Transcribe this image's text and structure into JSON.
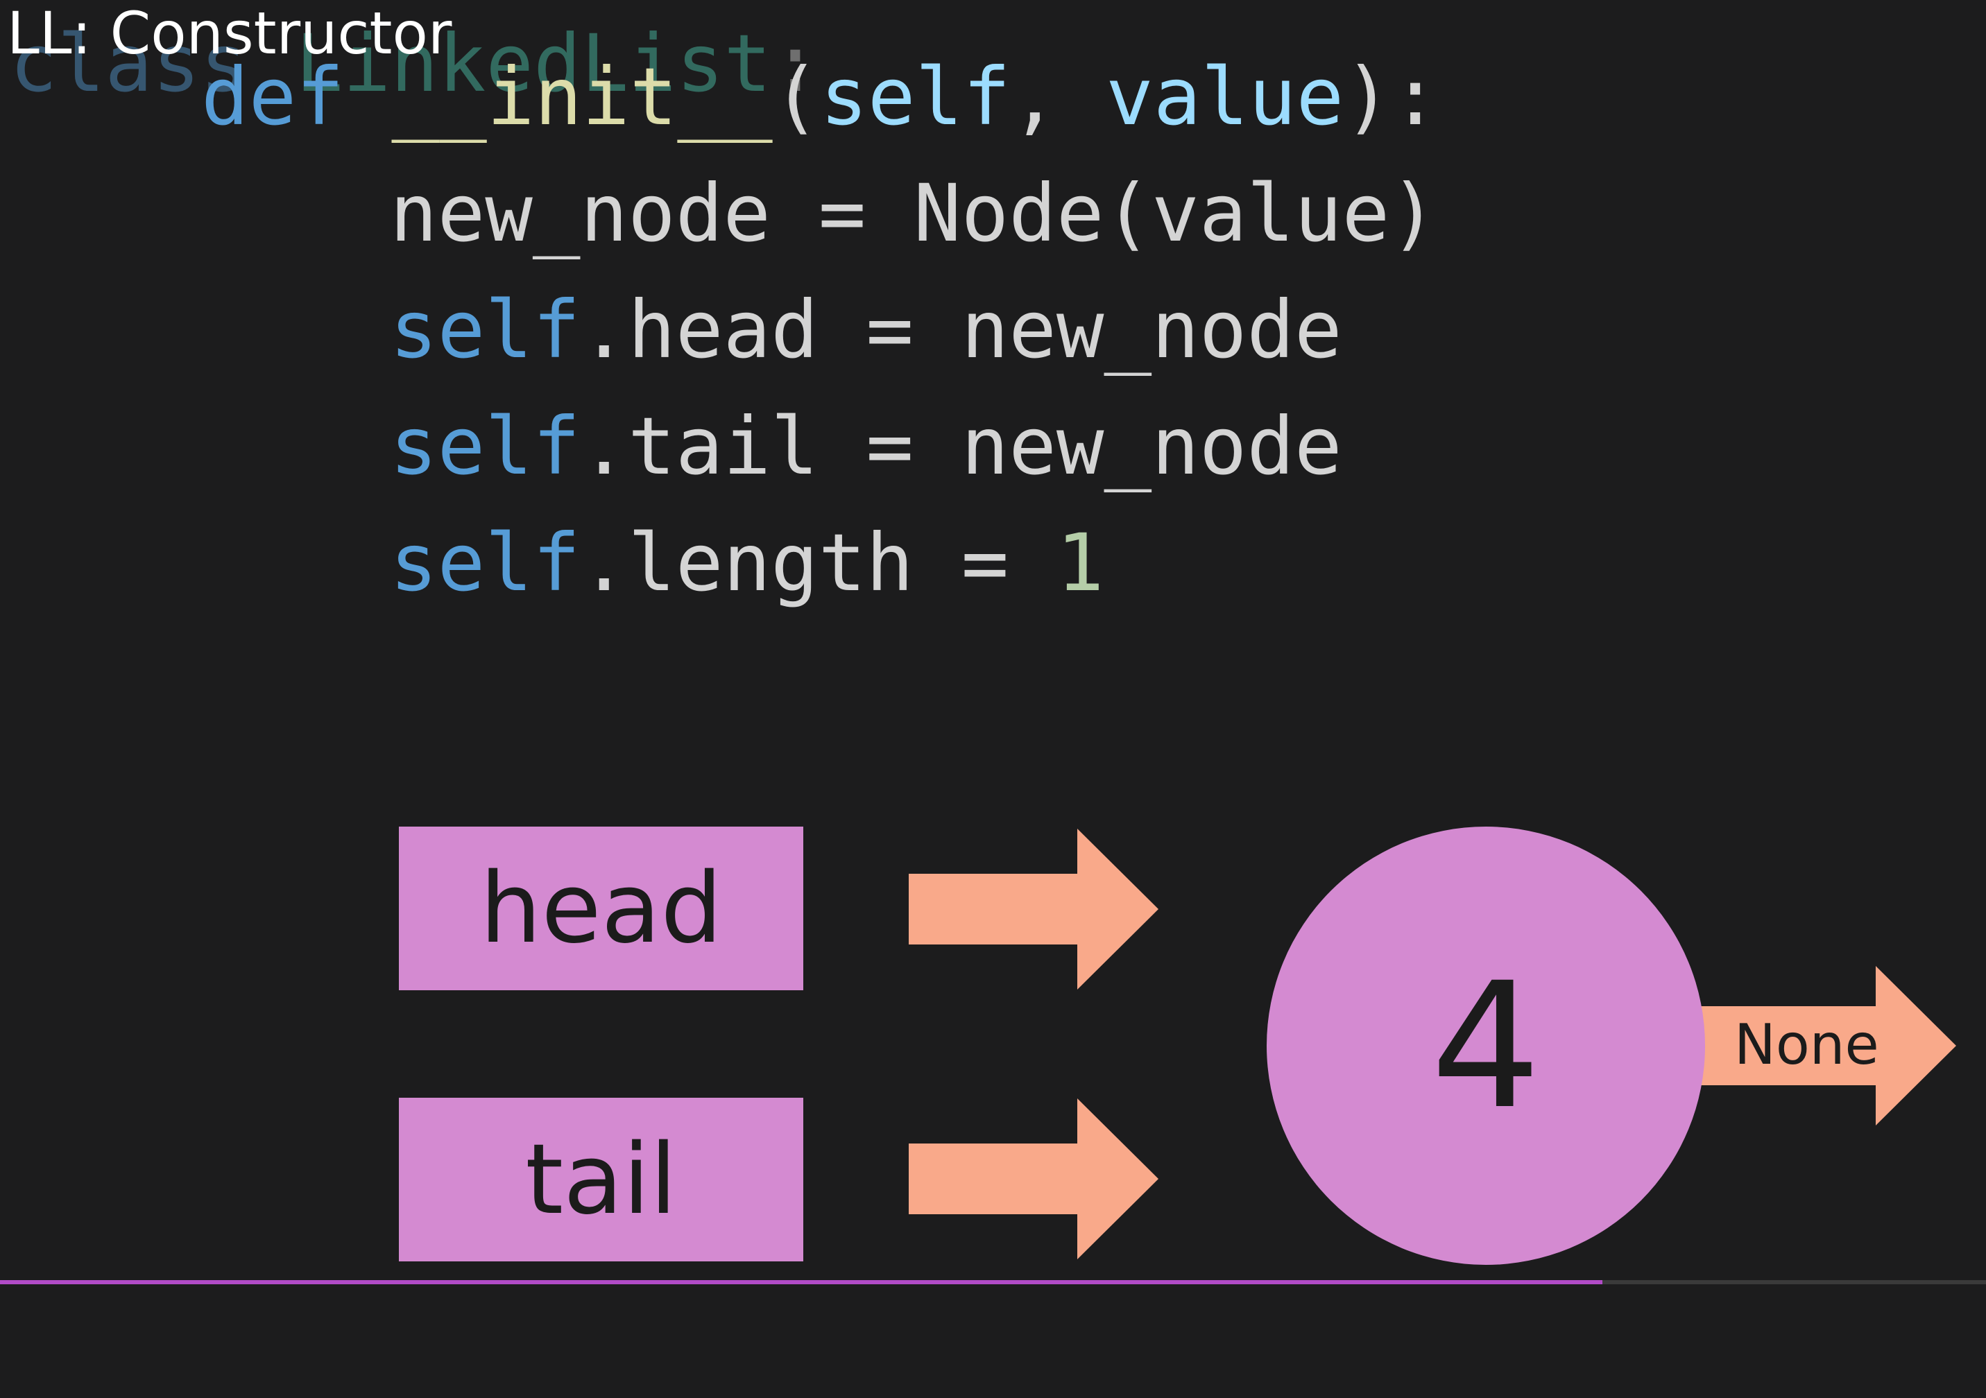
{
  "title": "LL: Constructor",
  "code": {
    "line0": {
      "kw": "class",
      "name": "LinkedList",
      "colon": ":"
    },
    "line1": {
      "kw": "def",
      "fn": "__init__",
      "open": "(",
      "p1": "self",
      "comma": ", ",
      "p2": "value",
      "close": "):"
    },
    "line2": {
      "text": "new_node = Node(value)"
    },
    "line3": {
      "self": "self",
      "rest": ".head = new_node"
    },
    "line4": {
      "self": "self",
      "rest": ".tail = new_node"
    },
    "line5": {
      "self": "self",
      "rest": ".length = ",
      "num": "1"
    }
  },
  "diagram": {
    "head_label": "head",
    "tail_label": "tail",
    "node_value": "4",
    "none_label": "None"
  },
  "colors": {
    "background": "#1c1c1d",
    "box": "#d48ad1",
    "arrow": "#f9a98a",
    "keyword": "#569cd6",
    "class_name": "#4ec9b0",
    "function": "#dcdcaa",
    "param": "#9cdcfe",
    "number": "#b5cea8"
  }
}
